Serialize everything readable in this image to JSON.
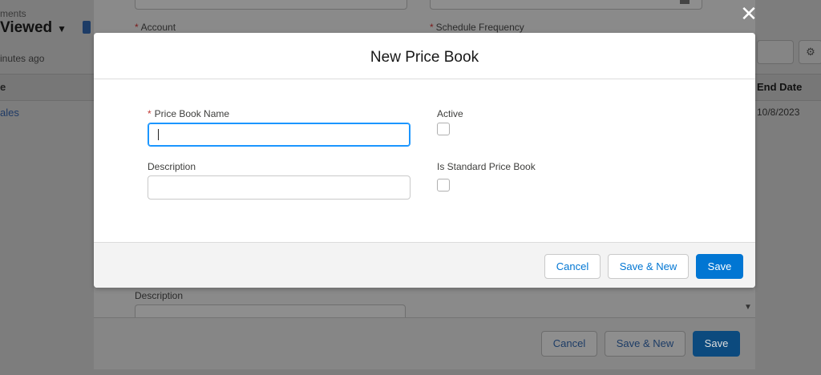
{
  "background_page": {
    "breadcrumb": "ments",
    "title": "Viewed",
    "title_caret": "▼",
    "updated": "inutes ago",
    "column_left": "e",
    "column_end_date": "End Date",
    "cell_left": "ales",
    "cell_end_date": "10/8/2023",
    "gear_icon": "⚙"
  },
  "underlying_form": {
    "account_label": "Account",
    "schedule_frequency_label": "Schedule Frequency",
    "description_label": "Description",
    "required_marker": "*",
    "buttons": {
      "cancel": "Cancel",
      "save_new": "Save & New",
      "save": "Save"
    },
    "scroll_arrow": "▼"
  },
  "close_icon": "✕",
  "modal": {
    "title": "New Price Book",
    "fields": {
      "name_label": "Price Book Name",
      "name_value": "",
      "description_label": "Description",
      "description_value": "",
      "active_label": "Active",
      "is_standard_label": "Is Standard Price Book",
      "required_marker": "*"
    },
    "buttons": {
      "cancel": "Cancel",
      "save_new": "Save & New",
      "save": "Save"
    }
  },
  "colors": {
    "brand_blue": "#0176d3",
    "focus_ring": "#1b96ff",
    "required_red": "#c23934"
  }
}
